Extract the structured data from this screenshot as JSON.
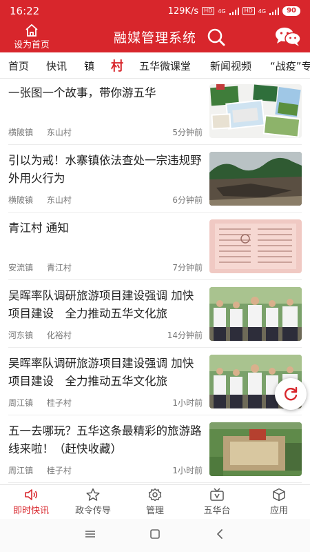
{
  "status_bar": {
    "time": "16:22",
    "speed": "129K/s",
    "hd1": "HD",
    "net1": "4G",
    "hd2": "HD",
    "net2": "4G",
    "battery": "90"
  },
  "header": {
    "home_label": "设为首页",
    "title": "融媒管理系统"
  },
  "tabs": [
    {
      "label": "首页"
    },
    {
      "label": "快讯"
    },
    {
      "label": "镇"
    },
    {
      "label": "村",
      "active": true
    },
    {
      "label": "五华微课堂"
    },
    {
      "label": "新闻视频"
    },
    {
      "label": "“战疫”专"
    }
  ],
  "feed": [
    {
      "title": "一张图一个故事，带你游五华",
      "town": "横陂镇",
      "village": "东山村",
      "time": "5分钟前",
      "image": "photo-collage"
    },
    {
      "title": "引以为戒！水寨镇依法查处一宗违规野外用火行为",
      "town": "横陂镇",
      "village": "东山村",
      "time": "6分钟前",
      "image": "burned-field"
    },
    {
      "title": "青江村 通知",
      "town": "安流镇",
      "village": "青江村",
      "time": "7分钟前",
      "image": "notice-document"
    },
    {
      "title": "吴晖率队调研旅游项目建设强调 加快项目建设　全力推动五华文化旅",
      "town": "河东镇",
      "village": "化裕村",
      "time": "14分钟前",
      "image": "officials-group"
    },
    {
      "title": "吴晖率队调研旅游项目建设强调 加快项目建设　全力推动五华文化旅",
      "town": "周江镇",
      "village": "桂子村",
      "time": "1小时前",
      "image": "officials-group"
    },
    {
      "title": "五一去哪玩？五华这条最精彩的旅游路线来啦！（赶快收藏）",
      "town": "周江镇",
      "village": "桂子村",
      "time": "1小时前",
      "image": "aerial-temple"
    }
  ],
  "bottom_nav": [
    {
      "label": "即时快讯",
      "icon": "speaker-icon",
      "active": true
    },
    {
      "label": "政令传导",
      "icon": "star-icon"
    },
    {
      "label": "管理",
      "icon": "gear-icon"
    },
    {
      "label": "五华台",
      "icon": "tv-icon"
    },
    {
      "label": "应用",
      "icon": "cube-icon"
    }
  ],
  "colors": {
    "brand_red": "#d8262c",
    "text": "#222222",
    "meta": "#777777"
  }
}
